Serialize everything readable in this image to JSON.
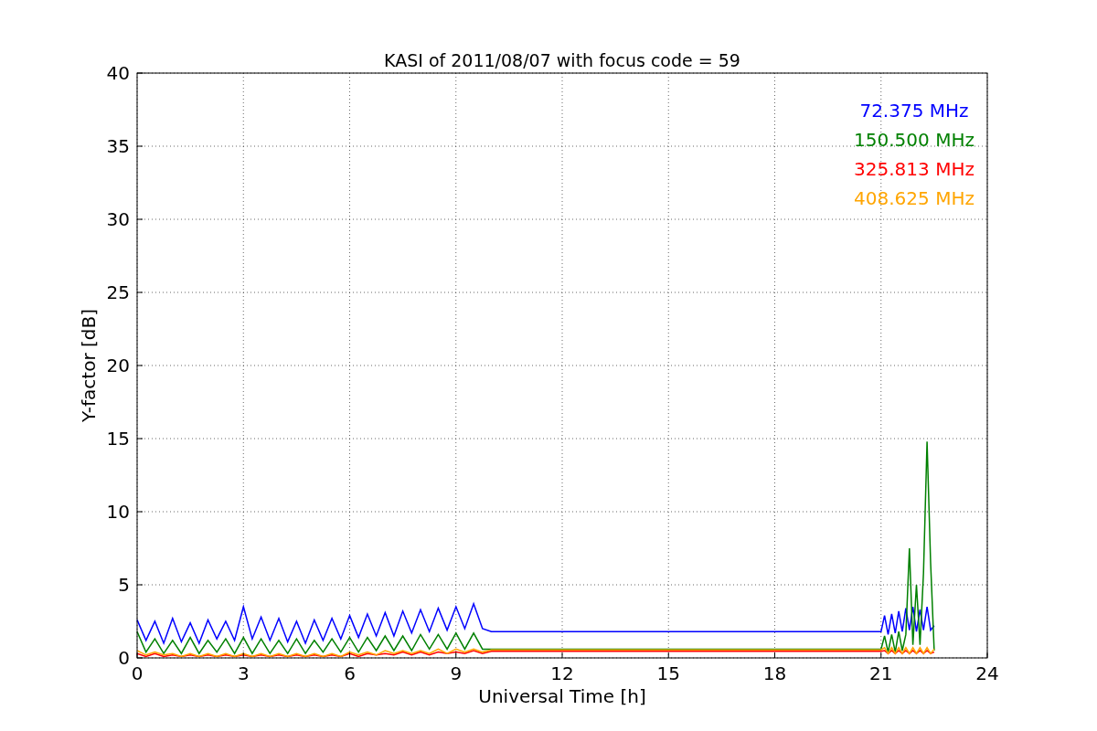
{
  "chart_data": {
    "type": "line",
    "title": "KASI of 2011/08/07 with focus code = 59",
    "xlabel": "Universal Time [h]",
    "ylabel": "Y-factor [dB]",
    "xlim": [
      0,
      24
    ],
    "ylim": [
      0,
      40
    ],
    "xticks": [
      0,
      3,
      6,
      9,
      12,
      15,
      18,
      21,
      24
    ],
    "yticks": [
      0,
      5,
      10,
      15,
      20,
      25,
      30,
      35,
      40
    ],
    "grid": true,
    "x": [
      0,
      0.25,
      0.5,
      0.75,
      1,
      1.25,
      1.5,
      1.75,
      2,
      2.25,
      2.5,
      2.75,
      3,
      3.25,
      3.5,
      3.75,
      4,
      4.25,
      4.5,
      4.75,
      5,
      5.25,
      5.5,
      5.75,
      6,
      6.25,
      6.5,
      6.75,
      7,
      7.25,
      7.5,
      7.75,
      8,
      8.25,
      8.5,
      8.75,
      9,
      9.25,
      9.5,
      9.75,
      10,
      21,
      21.1,
      21.2,
      21.3,
      21.4,
      21.5,
      21.6,
      21.7,
      21.8,
      21.9,
      22,
      22.1,
      22.2,
      22.3,
      22.4,
      22.5
    ],
    "series": [
      {
        "name": "72.375 MHz",
        "color": "#0000ff",
        "values": [
          2.6,
          1.2,
          2.5,
          1.0,
          2.7,
          1.1,
          2.4,
          1.0,
          2.6,
          1.3,
          2.5,
          1.2,
          3.5,
          1.3,
          2.8,
          1.2,
          2.7,
          1.1,
          2.5,
          1.0,
          2.6,
          1.2,
          2.7,
          1.3,
          2.9,
          1.4,
          3.0,
          1.5,
          3.1,
          1.5,
          3.2,
          1.7,
          3.3,
          1.8,
          3.4,
          1.9,
          3.5,
          2.0,
          3.7,
          2.0,
          1.8,
          1.8,
          2.9,
          1.6,
          3.0,
          1.7,
          3.2,
          1.8,
          3.4,
          1.9,
          3.5,
          1.8,
          3.3,
          1.9,
          3.5,
          1.9,
          2.2
        ]
      },
      {
        "name": "150.500 MHz",
        "color": "#008000",
        "values": [
          1.8,
          0.4,
          1.3,
          0.3,
          1.2,
          0.3,
          1.4,
          0.3,
          1.2,
          0.4,
          1.3,
          0.3,
          1.4,
          0.3,
          1.3,
          0.3,
          1.2,
          0.3,
          1.3,
          0.3,
          1.2,
          0.4,
          1.3,
          0.4,
          1.4,
          0.4,
          1.4,
          0.5,
          1.5,
          0.5,
          1.5,
          0.5,
          1.6,
          0.6,
          1.6,
          0.6,
          1.7,
          0.6,
          1.7,
          0.6,
          0.6,
          0.6,
          1.5,
          0.4,
          1.6,
          0.4,
          1.8,
          0.5,
          1.6,
          7.5,
          0.9,
          5.0,
          0.9,
          5.8,
          14.8,
          6.5,
          0.5
        ]
      },
      {
        "name": "325.813 MHz",
        "color": "#ff0000",
        "values": [
          0.3,
          0.1,
          0.3,
          0.1,
          0.2,
          0.1,
          0.2,
          0.1,
          0.2,
          0.1,
          0.2,
          0.1,
          0.2,
          0.1,
          0.2,
          0.1,
          0.2,
          0.1,
          0.2,
          0.1,
          0.2,
          0.1,
          0.2,
          0.1,
          0.3,
          0.1,
          0.3,
          0.2,
          0.3,
          0.2,
          0.4,
          0.2,
          0.4,
          0.2,
          0.4,
          0.3,
          0.4,
          0.3,
          0.5,
          0.3,
          0.45,
          0.45,
          0.5,
          0.3,
          0.5,
          0.3,
          0.5,
          0.3,
          0.5,
          0.3,
          0.5,
          0.3,
          0.5,
          0.3,
          0.5,
          0.3,
          0.4
        ]
      },
      {
        "name": "408.625 MHz",
        "color": "#ffa500",
        "values": [
          0.5,
          0.2,
          0.4,
          0.2,
          0.3,
          0.1,
          0.3,
          0.1,
          0.3,
          0.1,
          0.3,
          0.1,
          0.3,
          0.1,
          0.3,
          0.1,
          0.3,
          0.1,
          0.3,
          0.1,
          0.3,
          0.1,
          0.3,
          0.1,
          0.4,
          0.2,
          0.4,
          0.2,
          0.5,
          0.3,
          0.5,
          0.3,
          0.5,
          0.3,
          0.6,
          0.3,
          0.6,
          0.4,
          0.6,
          0.4,
          0.55,
          0.55,
          0.7,
          0.3,
          0.7,
          0.3,
          0.7,
          0.3,
          0.7,
          0.3,
          0.7,
          0.3,
          0.7,
          0.3,
          0.7,
          0.3,
          0.6
        ]
      }
    ]
  }
}
